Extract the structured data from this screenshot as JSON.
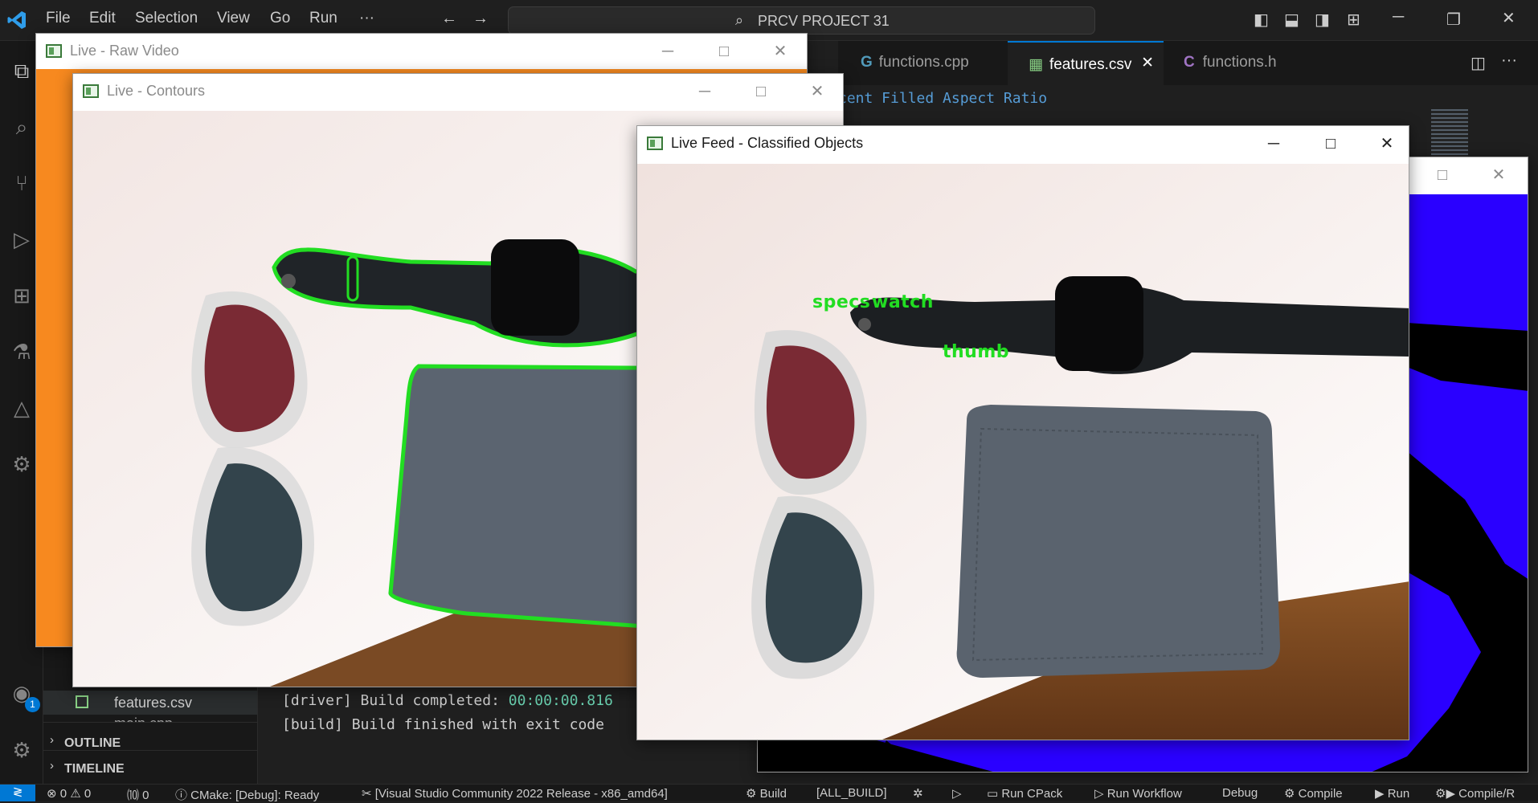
{
  "titlebar": {
    "menu": [
      "File",
      "Edit",
      "Selection",
      "View",
      "Go",
      "Run",
      "···"
    ],
    "search_label": "PRCV PROJECT 31"
  },
  "tabs": [
    {
      "label": "functions.cpp",
      "icon": "cpp-icon",
      "active": false
    },
    {
      "label": "features.csv",
      "icon": "csv-icon",
      "active": true
    },
    {
      "label": "functions.h",
      "icon": "c-header-icon",
      "active": false
    }
  ],
  "editor": {
    "visible_line": "cent Filled Aspect Ratio"
  },
  "sidebar": {
    "file_item": "features.csv",
    "file_item_partial": "main.cpp",
    "outline_label": "OUTLINE",
    "timeline_label": "TIMELINE",
    "accounts_badge": "1"
  },
  "terminal": {
    "line1_prefix": "[driver] Build completed: ",
    "line1_time": "00:00:00.816",
    "line2": "[build] Build finished with exit code "
  },
  "statusbar": {
    "problems": "⊗ 0 ⚠ 0",
    "ports": "⑽ 0",
    "cmake_status": "CMake: [Debug]: Ready",
    "kit": "[Visual Studio Community 2022 Release - x86_amd64]",
    "build": "Build",
    "target": "[ALL_BUILD]",
    "run_cpack": "Run CPack",
    "run_workflow": "Run Workflow",
    "debug": "Debug",
    "compile": "Compile",
    "run": "Run",
    "compile_run": "Compile/R"
  },
  "windows": {
    "raw_video": {
      "title": "Live - Raw Video"
    },
    "contours": {
      "title": "Live - Contours"
    },
    "classified": {
      "title": "Live Feed - Classified Objects",
      "labels": [
        "specs",
        "watch",
        "thumb"
      ]
    }
  },
  "colors": {
    "accent": "#0078d4",
    "contour_green": "#22dd22",
    "raw_video_orange": "#f7891f",
    "blue_window": "#2a00ff"
  }
}
